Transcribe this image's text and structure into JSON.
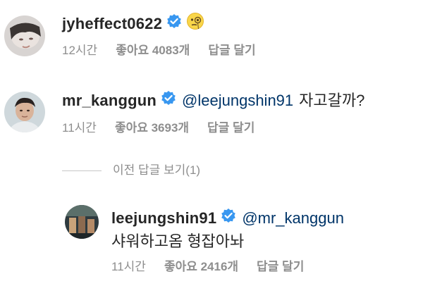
{
  "comments": [
    {
      "username": "jyheffect0622",
      "emoji": "face-with-monocle-emoji",
      "time": "12시간",
      "likes": "좋아요 4083개",
      "reply": "답글 달기"
    },
    {
      "username": "mr_kanggun",
      "mention": "@leejungshin91",
      "text": "자고갈까?",
      "time": "11시간",
      "likes": "좋아요 3693개",
      "reply": "답글 달기"
    }
  ],
  "view_previous": "이전 답글 보기(1)",
  "reply": {
    "username": "leejungshin91",
    "mention": "@mr_kanggun",
    "text": "샤워하고옴 형잡아놔",
    "time": "11시간",
    "likes": "좋아요 2416개",
    "reply": "답글 달기"
  },
  "colors": {
    "verified": "#3897f0",
    "mention": "#003569",
    "meta": "#8e8e8e"
  },
  "icons": [
    "verified-badge-icon",
    "face-with-monocle-emoji"
  ]
}
